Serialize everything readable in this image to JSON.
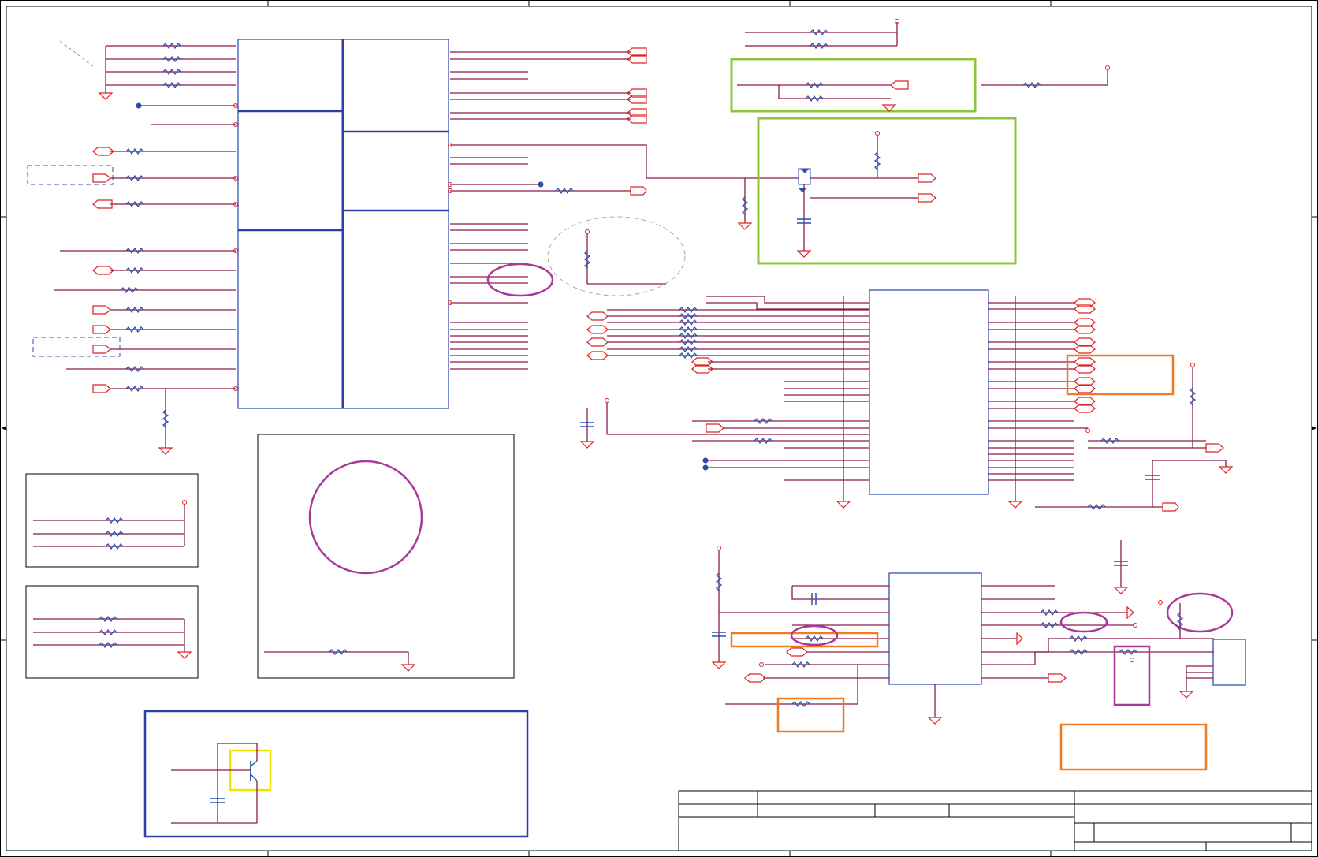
{
  "sheet": {
    "title": "",
    "colors": {
      "wire": "#8b1a4a",
      "pin": "#e02020",
      "component": "#2a4fa8",
      "green_highlight": "#8cc63f",
      "orange_highlight": "#f07b22",
      "purple_highlight": "#a8399a",
      "yellow_highlight": "#f2e600",
      "frame": "#000000"
    }
  }
}
